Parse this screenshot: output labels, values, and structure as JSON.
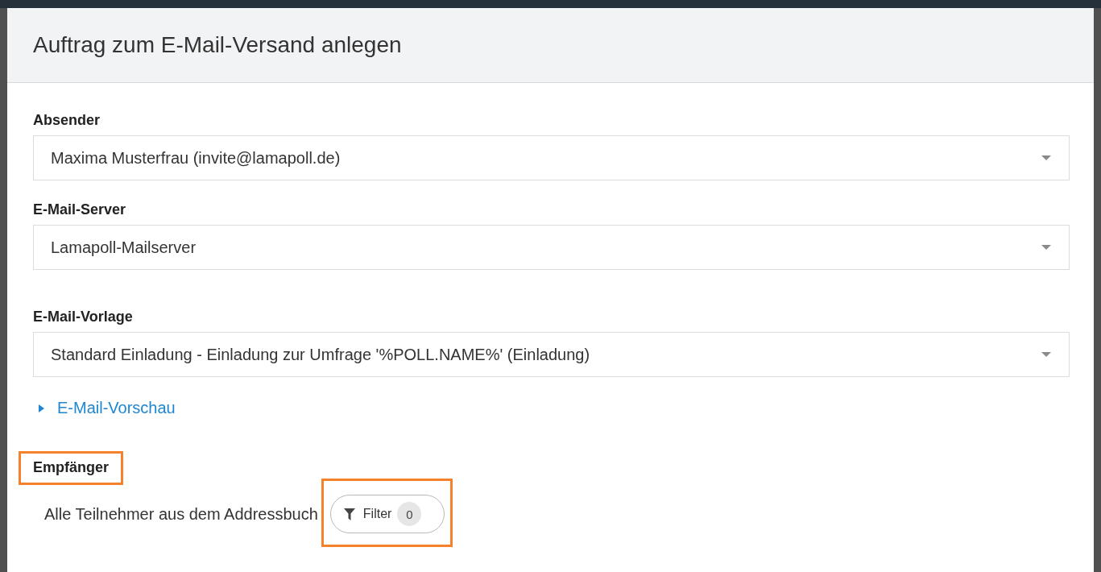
{
  "dialog": {
    "title": "Auftrag zum E-Mail-Versand anlegen"
  },
  "sender": {
    "label": "Absender",
    "value": "Maxima Musterfrau (invite@lamapoll.de)"
  },
  "mail_server": {
    "label": "E-Mail-Server",
    "value": "Lamapoll-Mailserver"
  },
  "template": {
    "label": "E-Mail-Vorlage",
    "value": "Standard Einladung - Einladung zur Umfrage '%POLL.NAME%' (Einladung)"
  },
  "preview_link": {
    "label": "E-Mail-Vorschau",
    "expanded": false
  },
  "recipients": {
    "label": "Empfänger",
    "highlighted": true,
    "description": "Alle Teilnehmer aus dem Addressbuch",
    "filter_button": {
      "label": "Filter",
      "count": "0",
      "highlighted": true
    }
  }
}
